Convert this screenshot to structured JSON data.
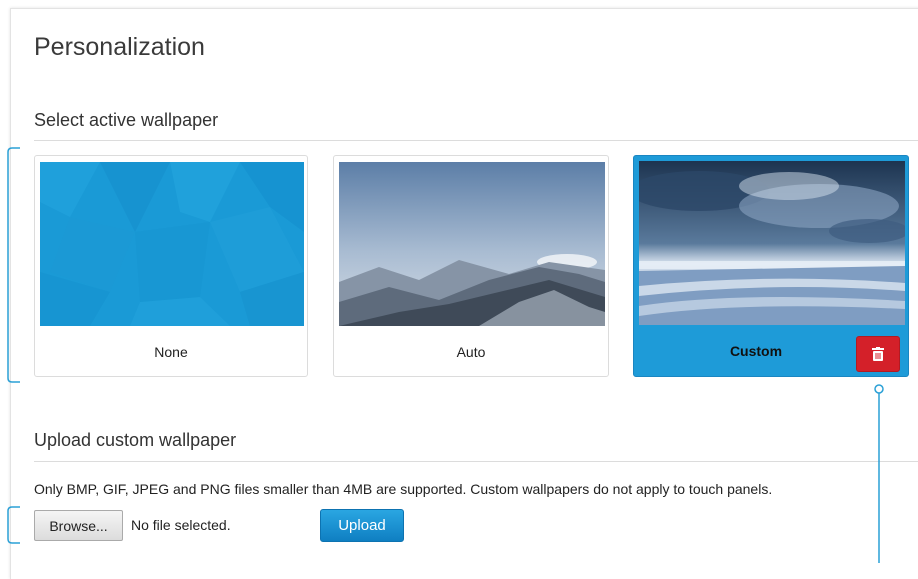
{
  "page": {
    "title": "Personalization"
  },
  "wallpaper": {
    "section_title": "Select active wallpaper",
    "options": [
      {
        "label": "None",
        "selected": false
      },
      {
        "label": "Auto",
        "selected": false
      },
      {
        "label": "Custom",
        "selected": true
      }
    ],
    "accent_color": "#1e9bd8",
    "delete_color": "#d42029"
  },
  "upload": {
    "section_title": "Upload custom wallpaper",
    "help_text": "Only BMP, GIF, JPEG and PNG files smaller than 4MB are supported. Custom wallpapers do not apply to touch panels.",
    "browse_label": "Browse...",
    "file_status": "No file selected.",
    "upload_label": "Upload"
  },
  "icons": {
    "delete": "trash-icon"
  }
}
